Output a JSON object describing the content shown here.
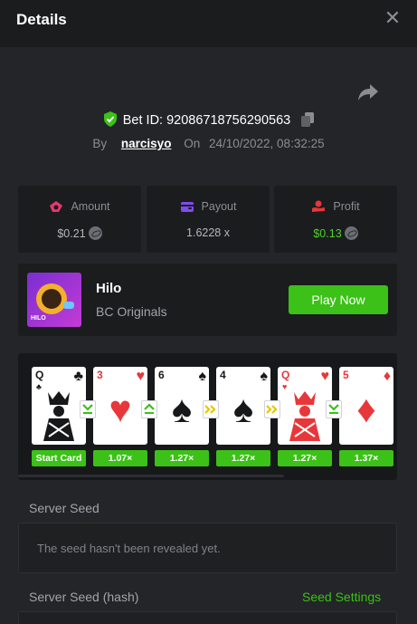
{
  "header": {
    "title": "Details",
    "close_icon": "close-icon"
  },
  "bet": {
    "label": "Bet ID:",
    "id": "92086718756290563",
    "by_label": "By",
    "user": "narcisyo",
    "on_label": "On",
    "datetime": "24/10/2022, 08:32:25"
  },
  "stats": {
    "amount": {
      "label": "Amount",
      "value": "$0.21",
      "icon": "bets-icon"
    },
    "payout": {
      "label": "Payout",
      "value": "1.6228 x",
      "icon": "wallet-icon"
    },
    "profit": {
      "label": "Profit",
      "value": "$0.13",
      "icon": "profit-icon"
    }
  },
  "game": {
    "name": "Hilo",
    "provider": "BC Originals",
    "thumb_label": "HILO",
    "play_label": "Play Now"
  },
  "cards": [
    {
      "rank": "Q",
      "suit": "♣",
      "color": "black",
      "multiplier": "Start Card"
    },
    {
      "rank": "3",
      "suit": "♥",
      "color": "red",
      "multiplier": "1.07×"
    },
    {
      "rank": "6",
      "suit": "♠",
      "color": "black",
      "multiplier": "1.27×"
    },
    {
      "rank": "4",
      "suit": "♠",
      "color": "black",
      "multiplier": "1.27×"
    },
    {
      "rank": "Q",
      "suit": "♥",
      "color": "red",
      "multiplier": "1.27×"
    },
    {
      "rank": "5",
      "suit": "♦",
      "color": "red",
      "multiplier": "1.37×"
    }
  ],
  "guesses": [
    "lower",
    "higher",
    "skip",
    "skip",
    "lower"
  ],
  "seed": {
    "server_label": "Server Seed",
    "server_value": "The seed hasn't been revealed yet.",
    "hash_label": "Server Seed (hash)",
    "settings_label": "Seed Settings"
  },
  "colors": {
    "accent_green": "#3bc117",
    "profit_green": "#4fd22b",
    "card_red": "#e8373a"
  }
}
